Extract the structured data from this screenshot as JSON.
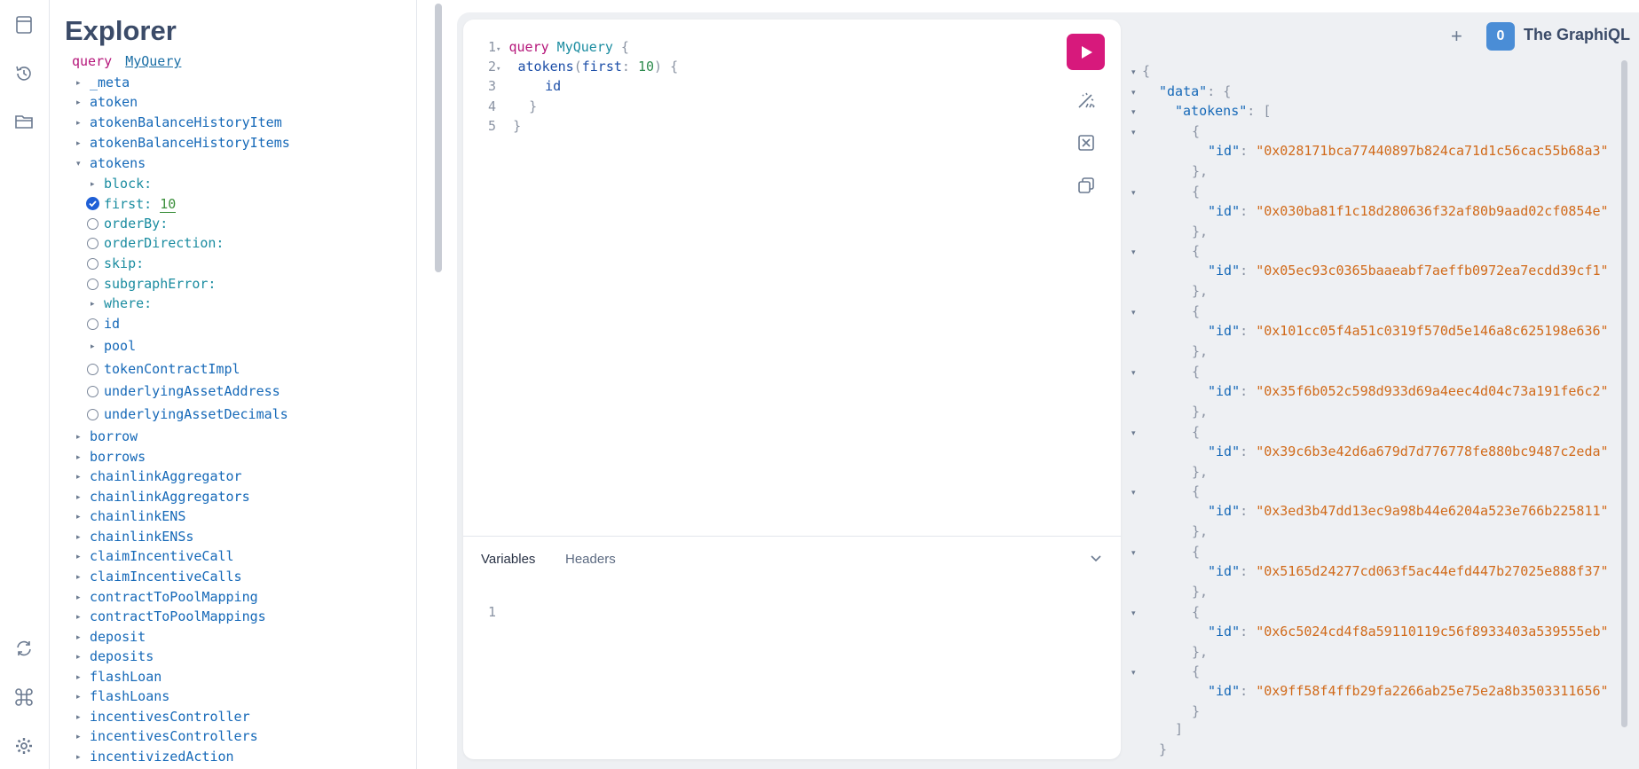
{
  "explorer": {
    "title": "Explorer",
    "operation_keyword": "query",
    "operation_name": "MyQuery",
    "items_top": [
      "_meta",
      "atoken",
      "atokenBalanceHistoryItem",
      "atokenBalanceHistoryItems",
      "atokens"
    ],
    "atokens_args": {
      "block": "block:",
      "first": "first:",
      "first_value": "10",
      "orderBy": "orderBy:",
      "orderDirection": "orderDirection:",
      "skip": "skip:",
      "subgraphError": "subgraphError:",
      "where": "where:"
    },
    "atokens_fields": [
      "id",
      "pool",
      "tokenContractImpl",
      "underlyingAssetAddress",
      "underlyingAssetDecimals"
    ],
    "items_bottom": [
      "borrow",
      "borrows",
      "chainlinkAggregator",
      "chainlinkAggregators",
      "chainlinkENS",
      "chainlinkENSs",
      "claimIncentiveCall",
      "claimIncentiveCalls",
      "contractToPoolMapping",
      "contractToPoolMappings",
      "deposit",
      "deposits",
      "flashLoan",
      "flashLoans",
      "incentivesController",
      "incentivesControllers",
      "incentivizedAction"
    ]
  },
  "editor": {
    "line_numbers": [
      "1",
      "2",
      "3",
      "4",
      "5"
    ],
    "line1_kw": "query",
    "line1_name": "MyQuery",
    "line1_brace": "{",
    "line2_field": "atokens",
    "line2_paren_open": "(",
    "line2_arg": "first",
    "line2_colon": ":",
    "line2_value": "10",
    "line2_rest": ") {",
    "line3_field": "id",
    "line4_brace": "}",
    "line5_brace": "}"
  },
  "variables": {
    "tab_variables": "Variables",
    "tab_headers": "Headers",
    "line_number": "1"
  },
  "header": {
    "plus": "+",
    "logo_letter": "0",
    "app_name": "The GraphiQL"
  },
  "response": {
    "open_brace": "{",
    "data_key": "\"data\"",
    "atokens_key": "\"atokens\"",
    "id_key": "\"id\"",
    "ids": [
      "\"0x028171bca77440897b824ca71d1c56cac55b68a3\"",
      "\"0x030ba81f1c18d280636f32af80b9aad02cf0854e\"",
      "\"0x05ec93c0365baaeabf7aeffb0972ea7ecdd39cf1\"",
      "\"0x101cc05f4a51c0319f570d5e146a8c625198e636\"",
      "\"0x35f6b052c598d933d69a4eec4d04c73a191fe6c2\"",
      "\"0x39c6b3e42d6a679d7d776778fe880bc9487c2eda\"",
      "\"0x3ed3b47dd13ec9a98b44e6204a523e766b225811\"",
      "\"0x5165d24277cd063f5ac44efd447b27025e888f37\"",
      "\"0x6c5024cd4f8a59110119c56f8933403a539555eb\"",
      "\"0x9ff58f4ffb29fa2266ab25e75e2a8b3503311656\""
    ]
  },
  "colors": {
    "accent": "#d7197c",
    "field": "#1669b8",
    "string": "#d16a1a",
    "keyword": "#b5167a"
  }
}
